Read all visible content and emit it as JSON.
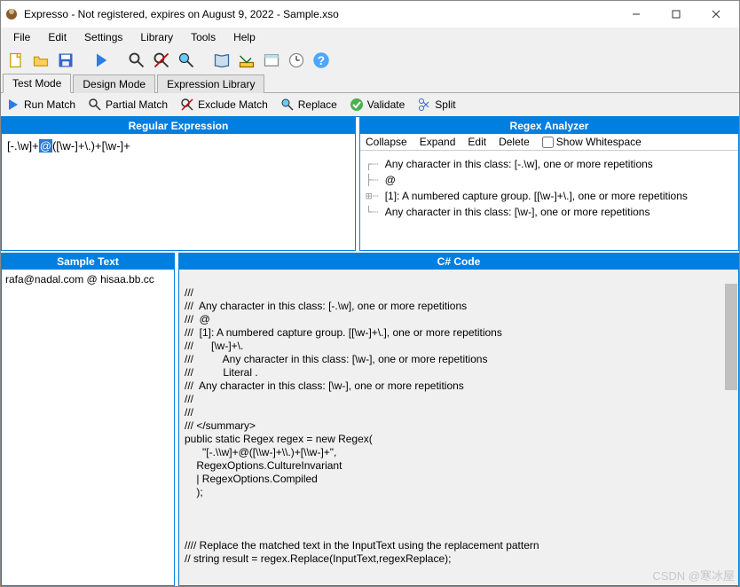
{
  "title": "Expresso - Not registered, expires on August 9, 2022 - Sample.xso",
  "menu": {
    "file": "File",
    "edit": "Edit",
    "settings": "Settings",
    "library": "Library",
    "tools": "Tools",
    "help": "Help"
  },
  "tabs": {
    "test": "Test Mode",
    "design": "Design Mode",
    "library": "Expression Library"
  },
  "actions": {
    "run": "Run Match",
    "partial": "Partial Match",
    "exclude": "Exclude Match",
    "replace": "Replace",
    "validate": "Validate",
    "split": "Split"
  },
  "panels": {
    "regex": "Regular Expression",
    "analyzer": "Regex Analyzer",
    "sample": "Sample Text",
    "code": "C# Code"
  },
  "analyzer_tools": {
    "collapse": "Collapse",
    "expand": "Expand",
    "edit": "Edit",
    "delete": "Delete",
    "show_ws": "Show Whitespace"
  },
  "regex": {
    "pre": "[-.\\w]+",
    "hl": "@",
    "post": "([\\w-]+\\.)+[\\w-]+"
  },
  "tree": {
    "n1": "Any character in this class: [-.\\w], one or more repetitions",
    "n2": "@",
    "n3": "[1]: A numbered capture group. [[\\w-]+\\.], one or more repetitions",
    "n4": "Any character in this class: [\\w-], one or more repetitions"
  },
  "sample": "rafa@nadal.com @ hisaa.bb.cc",
  "code": {
    "l1": "///",
    "l2": "///  Any character in this class: [-.\\w], one or more repetitions",
    "l3": "///  @",
    "l4": "///  [1]: A numbered capture group. [[\\w-]+\\.], one or more repetitions",
    "l5": "///      [\\w-]+\\.",
    "l6": "///          Any character in this class: [\\w-], one or more repetitions",
    "l7": "///          Literal .",
    "l8": "///  Any character in this class: [\\w-], one or more repetitions",
    "l9": "///",
    "l10": "///",
    "l11": "/// </summary>",
    "l12": "public static Regex regex = new Regex(",
    "l13": "      \"[-.\\\\w]+@([\\\\w-]+\\\\.)+[\\\\w-]+\",",
    "l14": "    RegexOptions.CultureInvariant",
    "l15": "    | RegexOptions.Compiled",
    "l16": "    );",
    "l17": "",
    "l18": "",
    "l19": "",
    "l20": "//// Replace the matched text in the InputText using the replacement pattern",
    "l21": "// string result = regex.Replace(InputText,regexReplace);"
  },
  "watermark": "CSDN @寒冰屋"
}
